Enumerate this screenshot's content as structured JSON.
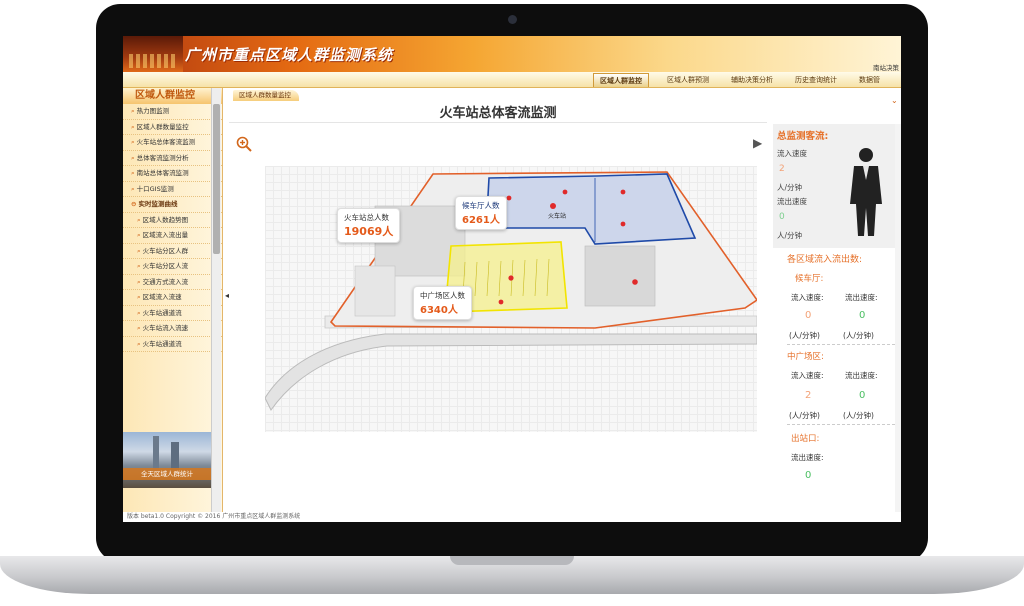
{
  "app": {
    "title": "广州市重点区域人群监测系统",
    "user": "南站决策"
  },
  "nav": {
    "tabs": [
      "区域人群监控",
      "区域人群预测",
      "辅助决策分析",
      "历史查询统计",
      "数据管"
    ]
  },
  "sidebar": {
    "title": "区域人群监控",
    "items": [
      "热力图监测",
      "区域人群数量监控",
      "火车站总体客流监测",
      "总体客流监测分析",
      "南站总体客流监测",
      "十口GIS监测"
    ],
    "group": "实时监测曲线",
    "sub_items": [
      "区域人数趋势图",
      "区域流入流出量",
      "火车站分区人群",
      "火车站分区人流",
      "交通方式流入流",
      "区域流入流速",
      "火车站通道流",
      "火车站流入流速",
      "火车站通道流"
    ],
    "bottom": "全天区域人群统计"
  },
  "main": {
    "breadcrumb": "区域人群数量监控",
    "title": "火车站总体客流监测",
    "bubbles": {
      "total": {
        "label": "火车站总人数",
        "value": "19069人"
      },
      "waiting": {
        "label": "候车厅人数",
        "value": "6261人"
      },
      "plaza": {
        "label": "中广场区人数",
        "value": "6340人"
      }
    },
    "map_labels": {
      "station": "火车站"
    }
  },
  "right_panel": {
    "total_title": "总监测客流:",
    "in_speed_label": "流入速度",
    "in_speed_value": "2",
    "out_speed_label": "流出速度",
    "out_speed_value": "0",
    "unit": "人/分钟",
    "areas_title": "各区域流入流出数:",
    "areas": [
      {
        "name": "候车厅:",
        "in_label": "流入速度:",
        "out_label": "流出速度:",
        "in_value": "0",
        "out_value": "0",
        "in_unit": "(人/分钟)",
        "out_unit": "(人/分钟)"
      },
      {
        "name": "中广场区:",
        "in_label": "流入速度:",
        "out_label": "流出速度:",
        "in_value": "2",
        "out_value": "0",
        "in_unit": "(人/分钟)",
        "out_unit": "(人/分钟)"
      }
    ],
    "exit": {
      "name": "出站口:",
      "out_label": "流出速度:",
      "out_value": "0"
    }
  },
  "footer": {
    "text": "版本 beta1.0  Copyright © 2016 广州市重点区域人群监测系统"
  },
  "colors": {
    "accent": "#e6712a",
    "header_dark": "#b23a10",
    "value_red": "#e45a1a",
    "value_green": "#4bbf63",
    "zone_blue": "#1f4aa8",
    "zone_yellow": "#f2e400"
  }
}
